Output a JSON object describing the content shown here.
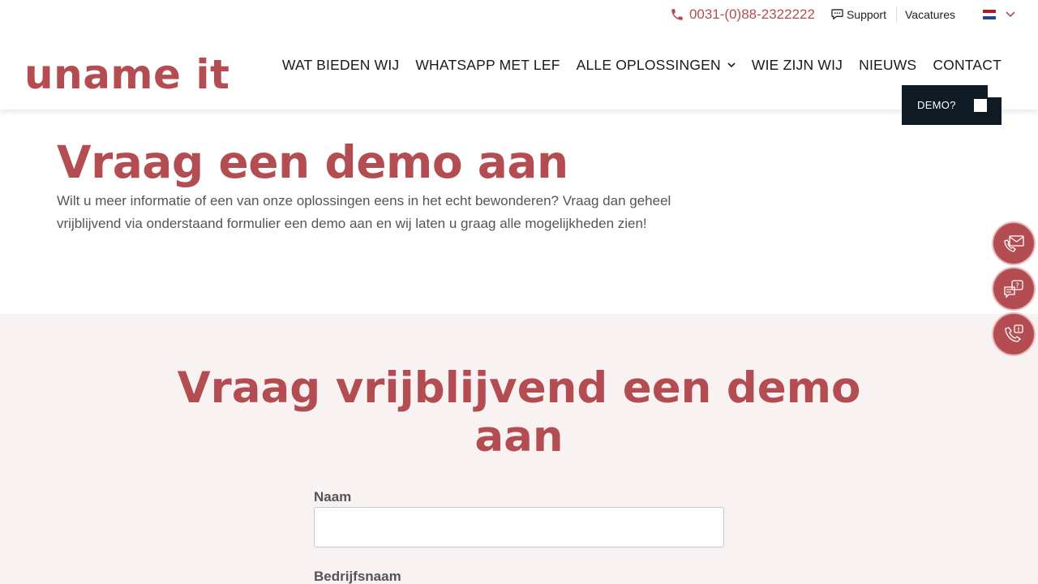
{
  "topbar": {
    "phone": "0031-(0)88-2322222",
    "support": "Support",
    "vacatures": "Vacatures"
  },
  "logo": "uname it",
  "nav": {
    "items": [
      {
        "label": "WAT BIEDEN WIJ"
      },
      {
        "label": "WHATSAPP MET LEF"
      },
      {
        "label": "ALLE OPLOSSINGEN"
      },
      {
        "label": "WIE ZIJN WIJ"
      },
      {
        "label": "NIEUWS"
      },
      {
        "label": "CONTACT"
      }
    ],
    "demo": "DEMO?"
  },
  "hero": {
    "title": "Vraag een demo aan",
    "text": "Wilt u meer informatie of een van onze oplossingen eens in het echt bewonderen? Vraag dan geheel vrijblijvend via onderstaand formulier een demo aan en wij laten u graag alle mogelijkheden zien!"
  },
  "form": {
    "title": "Vraag vrijblijvend een demo aan",
    "fields": [
      {
        "label": "Naam",
        "value": ""
      },
      {
        "label": "Bedrijfsnaam"
      }
    ]
  },
  "colors": {
    "accent": "#b34d52",
    "dark": "#0e1b24",
    "section_bg": "#f8f3f2"
  },
  "icons": [
    "phone-icon",
    "chat-icon",
    "nl-flag-icon",
    "chevron-down-icon",
    "mail-contact-icon",
    "chat-question-icon",
    "phone-contact-icon"
  ]
}
